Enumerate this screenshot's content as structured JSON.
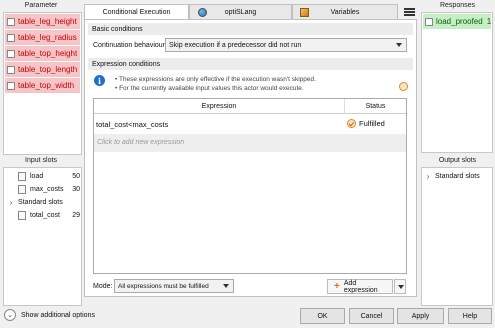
{
  "parameter_panel": {
    "title": "Parameter",
    "items": [
      {
        "label": "table_leg_height"
      },
      {
        "label": "table_leg_radius"
      },
      {
        "label": "table_top_height"
      },
      {
        "label": "table_top_length"
      },
      {
        "label": "table_top_width"
      }
    ]
  },
  "input_slots": {
    "title": "Input slots",
    "items": [
      {
        "label": "load",
        "value": "50"
      },
      {
        "label": "max_costs",
        "value": "30"
      }
    ],
    "group": {
      "label": "Standard slots",
      "items": [
        {
          "label": "total_cost",
          "value": "29"
        }
      ]
    }
  },
  "responses_panel": {
    "title": "Responses",
    "items": [
      {
        "label": "load_proofed",
        "value": "1"
      }
    ]
  },
  "output_slots": {
    "title": "Output slots",
    "group": {
      "label": "Standard slots"
    }
  },
  "tabs": [
    {
      "label": "Conditional Execution",
      "icon": "none",
      "active": true
    },
    {
      "label": "optiSLang",
      "icon": "globe-icon",
      "active": false
    },
    {
      "label": "Variables",
      "icon": "variables-icon",
      "active": false
    }
  ],
  "basic_conditions": {
    "header": "Basic conditions",
    "continuation_label": "Continuation behaviour:",
    "continuation_value": "Skip execution if a predecessor did not run"
  },
  "expression_conditions": {
    "header": "Expression conditions",
    "note1": "• These expressions are only effective if the execution wasn't skipped.",
    "note2": "• For the currently available input values this actor would execute.",
    "columns": {
      "expression": "Expression",
      "status": "Status"
    },
    "rows": [
      {
        "expression": "total_cost<max_costs",
        "status": "Fulfilled"
      }
    ],
    "add_placeholder": "Click to add new expression"
  },
  "mode": {
    "label": "Mode:",
    "value": "All expressions must be fulfilled"
  },
  "add_expression_label": "Add expression",
  "footer": {
    "show_more": "Show additional options",
    "ok": "OK",
    "cancel": "Cancel",
    "apply": "Apply",
    "help": "Help"
  },
  "colors": {
    "parameter_bg": "#f5c5c7",
    "parameter_text": "#cc0000",
    "response_bg": "#c6efc6",
    "response_text": "#075f07",
    "accent": "#e0701a",
    "info": "#1a6fd0"
  }
}
